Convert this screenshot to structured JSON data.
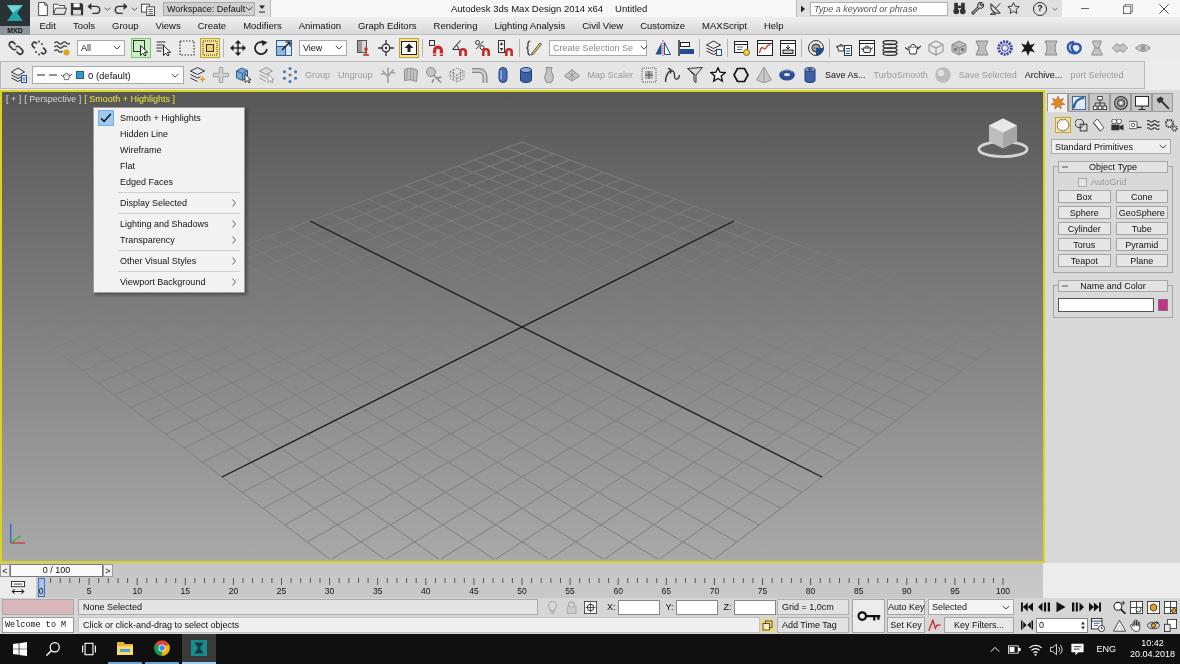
{
  "app_button": {
    "label": "MXD"
  },
  "quick_access": {
    "workspace": "Workspace: Default"
  },
  "title": {
    "app": "Autodesk 3ds Max Design 2014 x64",
    "document": "Untitled"
  },
  "search": {
    "placeholder": "Type a keyword or phrase"
  },
  "help": {
    "label": "?"
  },
  "menu_bar": [
    "Edit",
    "Tools",
    "Group",
    "Views",
    "Create",
    "Modifiers",
    "Animation",
    "Graph Editors",
    "Rendering",
    "Lighting Analysis",
    "Civil View",
    "Customize",
    "MAXScript",
    "Help"
  ],
  "main_toolbar": [
    {
      "kind": "button",
      "active": false
    },
    {
      "kind": "button",
      "active": false
    },
    {
      "kind": "button",
      "active": false
    },
    {
      "kind": "dropdown",
      "value": "All"
    },
    {
      "kind": "tool",
      "active": true
    },
    {
      "kind": "button",
      "active": false
    },
    {
      "kind": "button",
      "active": false
    },
    {
      "kind": "button",
      "active": true
    },
    {
      "kind": "tool",
      "active": false
    },
    {
      "kind": "tool",
      "active": false
    },
    {
      "kind": "tool",
      "active": false
    },
    {
      "kind": "dropdown",
      "value": "View"
    },
    {
      "kind": "button",
      "active": false
    },
    {
      "kind": "tool",
      "active": false
    },
    {
      "kind": "button",
      "active": true
    },
    {
      "kind": "button",
      "active": false
    },
    {
      "kind": "button",
      "active": false
    },
    {
      "kind": "button",
      "active": false
    },
    {
      "kind": "button",
      "active": false
    },
    {
      "kind": "button",
      "active": false
    },
    {
      "kind": "combo",
      "placeholder": "Create Selection Se"
    },
    {
      "kind": "button",
      "active": false
    },
    {
      "kind": "button",
      "active": false
    },
    {
      "kind": "button",
      "active": false
    },
    {
      "kind": "button",
      "active": false
    },
    {
      "kind": "button",
      "active": false
    },
    {
      "kind": "button",
      "active": false
    },
    {
      "kind": "button",
      "active": false
    },
    {
      "kind": "button",
      "active": false
    },
    {
      "kind": "button",
      "active": false
    },
    {
      "kind": "button",
      "active": false
    },
    {
      "kind": "button",
      "active": false
    },
    {
      "kind": "button",
      "active": false
    },
    {
      "kind": "button",
      "active": false
    },
    {
      "kind": "button",
      "active": false
    },
    {
      "kind": "button",
      "active": false
    },
    {
      "kind": "button",
      "active": false
    },
    {
      "kind": "button",
      "active": false
    },
    {
      "kind": "button",
      "active": false
    },
    {
      "kind": "button",
      "active": false
    },
    {
      "kind": "button",
      "active": false
    },
    {
      "kind": "button",
      "active": false
    }
  ],
  "layer_toolbar": [
    {
      "kind": "icon"
    },
    {
      "kind": "layer",
      "value": "0 (default)"
    },
    {
      "kind": "icon"
    },
    {
      "kind": "icon"
    },
    {
      "kind": "icon"
    },
    {
      "kind": "icon"
    },
    {
      "kind": "icon"
    },
    {
      "kind": "text",
      "label": "Group",
      "disabled": true
    },
    {
      "kind": "text",
      "label": "Ungroup",
      "disabled": true
    },
    {
      "kind": "icon"
    },
    {
      "kind": "icon"
    },
    {
      "kind": "icon"
    },
    {
      "kind": "icon"
    },
    {
      "kind": "icon"
    },
    {
      "kind": "icon"
    },
    {
      "kind": "icon"
    },
    {
      "kind": "icon"
    },
    {
      "kind": "icon"
    },
    {
      "kind": "text",
      "label": "Map Scaler",
      "disabled": true
    },
    {
      "kind": "icon"
    },
    {
      "kind": "icon"
    },
    {
      "kind": "icon"
    },
    {
      "kind": "icon"
    },
    {
      "kind": "icon"
    },
    {
      "kind": "icon"
    },
    {
      "kind": "icon"
    },
    {
      "kind": "icon"
    },
    {
      "kind": "text",
      "label": "Save As...",
      "disabled": false
    },
    {
      "kind": "text",
      "label": "TurboSmooth",
      "disabled": true
    },
    {
      "kind": "icon"
    },
    {
      "kind": "text",
      "label": "Save Selected",
      "disabled": true
    },
    {
      "kind": "text",
      "label": "Archive...",
      "disabled": false
    },
    {
      "kind": "text",
      "label": "port Selected",
      "disabled": true
    }
  ],
  "viewport": {
    "labels": [
      {
        "text": "[ + ]",
        "selected": false
      },
      {
        "text": "[ Perspective ]",
        "selected": false
      },
      {
        "text": "[ Smooth + Highlights ]",
        "selected": true
      }
    ],
    "menu": {
      "groups": [
        {
          "items": [
            {
              "label": "Smooth + Highlights",
              "checked": true,
              "submenu": false
            },
            {
              "label": "Hidden Line",
              "checked": false,
              "submenu": false
            },
            {
              "label": "Wireframe",
              "checked": false,
              "submenu": false
            },
            {
              "label": "Flat",
              "checked": false,
              "submenu": false
            },
            {
              "label": "Edged Faces",
              "checked": false,
              "submenu": false
            }
          ]
        },
        {
          "items": [
            {
              "label": "Display Selected",
              "checked": false,
              "submenu": true
            }
          ]
        },
        {
          "items": [
            {
              "label": "Lighting and Shadows",
              "checked": false,
              "submenu": true
            },
            {
              "label": "Transparency",
              "checked": false,
              "submenu": true
            }
          ]
        },
        {
          "items": [
            {
              "label": "Other Visual Styles",
              "checked": false,
              "submenu": true
            }
          ]
        },
        {
          "items": [
            {
              "label": "Viewport Background",
              "checked": false,
              "submenu": true
            }
          ]
        }
      ]
    }
  },
  "command_panel": {
    "tabs": [
      {
        "selected": true
      },
      {
        "selected": false
      },
      {
        "selected": false
      },
      {
        "selected": false
      },
      {
        "selected": false
      },
      {
        "selected": false
      }
    ],
    "categories": [
      {
        "selected": true
      },
      {
        "selected": false
      },
      {
        "selected": false
      },
      {
        "selected": false
      },
      {
        "selected": false
      },
      {
        "selected": false
      },
      {
        "selected": false
      }
    ],
    "type": "Standard Primitives",
    "rollouts": [
      {
        "kind": "object_type",
        "title": "Object Type",
        "expanded": true,
        "checkbox": {
          "label": "AutoGrid",
          "checked": false,
          "disabled": true
        },
        "buttons": [
          "Box",
          "Cone",
          "Sphere",
          "GeoSphere",
          "Cylinder",
          "Tube",
          "Torus",
          "Pyramid",
          "Teapot",
          "Plane"
        ]
      },
      {
        "kind": "name_color",
        "title": "Name and Color",
        "expanded": true
      }
    ]
  },
  "time_slider": {
    "prev": "<",
    "label": "0 / 100",
    "next": ">",
    "level": 0
  },
  "track_bar": {
    "labels": [
      "0",
      "5",
      "10",
      "15",
      "20",
      "25",
      "30",
      "35",
      "40",
      "45",
      "50",
      "55",
      "60",
      "65",
      "70",
      "75",
      "80",
      "85",
      "90",
      "95",
      "100"
    ]
  },
  "status": {
    "listener_output": "Welcome to M",
    "selection": "None Selected",
    "prompt": "Click or click-and-drag to select objects",
    "coords": [
      "X:",
      "Y:",
      "Z:"
    ],
    "grid": "Grid = 1,0cm",
    "time_tag": "Add Time Tag",
    "auto_key": "Auto Key",
    "set_key": "Set Key",
    "key_set": "Selected",
    "key_filters": "Key Filters...",
    "frame": "0"
  },
  "taskbar": {
    "apps": [
      {
        "running": true,
        "selected": false
      },
      {
        "running": true,
        "selected": false
      },
      {
        "running": true,
        "selected": true
      }
    ],
    "language": "ENG",
    "time": "10:42",
    "date": "20.04.2018"
  }
}
